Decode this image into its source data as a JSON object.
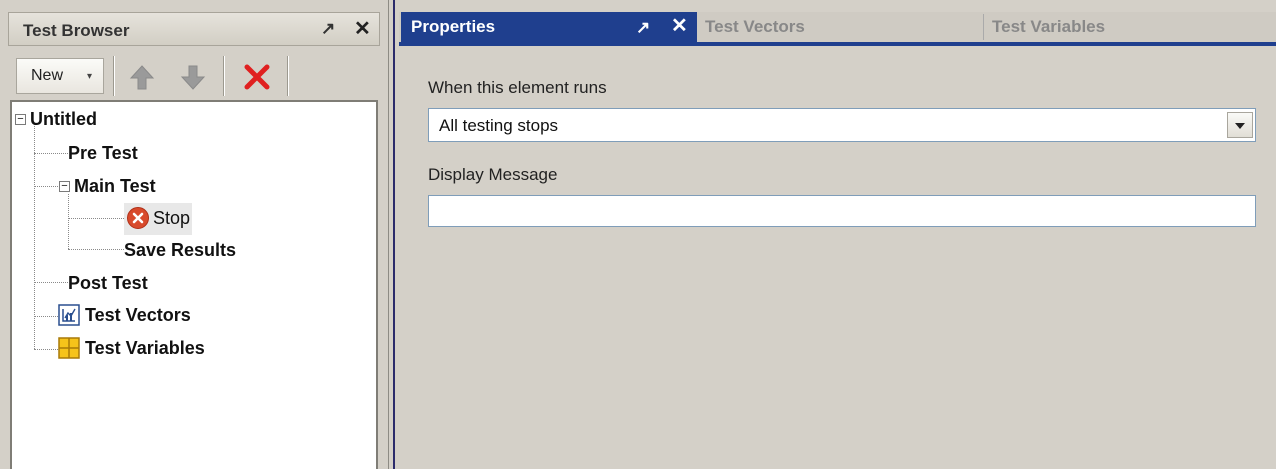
{
  "left_panel": {
    "title": "Test Browser",
    "pin_glyph": "↗",
    "close_glyph": "✕",
    "toolbar": {
      "new_label": "New",
      "new_dropdown_glyph": "▾",
      "icons": [
        "arrow-up-icon",
        "arrow-down-icon",
        "delete-icon"
      ]
    },
    "tree": {
      "root": "Untitled",
      "pre_test": "Pre Test",
      "main_test": "Main Test",
      "stop": "Stop",
      "save_results": "Save Results",
      "post_test": "Post Test",
      "test_vectors": "Test Vectors",
      "test_variables": "Test Variables",
      "expander_minus": "−"
    }
  },
  "right_panel": {
    "tabs": {
      "properties": "Properties",
      "test_vectors": "Test Vectors",
      "test_variables": "Test Variables"
    },
    "pin_glyph": "↗",
    "close_glyph": "✕",
    "when_label": "When this element runs",
    "when_value": "All testing stops",
    "display_label": "Display Message",
    "display_value": ""
  },
  "colors": {
    "active_tab": "#1f3f8e",
    "panel_bg": "#d4d0c8",
    "stop_icon": "#d84a2c",
    "delete_icon": "#e02020",
    "arrow_icon": "#9a9a9a"
  }
}
